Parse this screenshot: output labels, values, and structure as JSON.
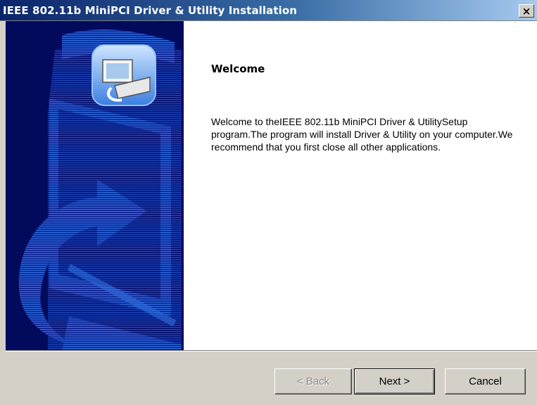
{
  "window": {
    "title": "IEEE 802.11b MiniPCI Driver & Utility Installation",
    "close_label": "×"
  },
  "main": {
    "heading": "Welcome",
    "body": "Welcome to theIEEE 802.11b MiniPCI Driver & UtilitySetup program.The program will install Driver & Utility on your computer.We recommend that you first close all other applications."
  },
  "buttons": {
    "back": "< Back",
    "next": "Next >",
    "cancel": "Cancel"
  },
  "colors": {
    "title_bar": "#0a246a",
    "art_background": "#020a5c",
    "art_accent": "#2a6bd8"
  },
  "icons": [
    "installer-computer-icon",
    "close-icon"
  ]
}
